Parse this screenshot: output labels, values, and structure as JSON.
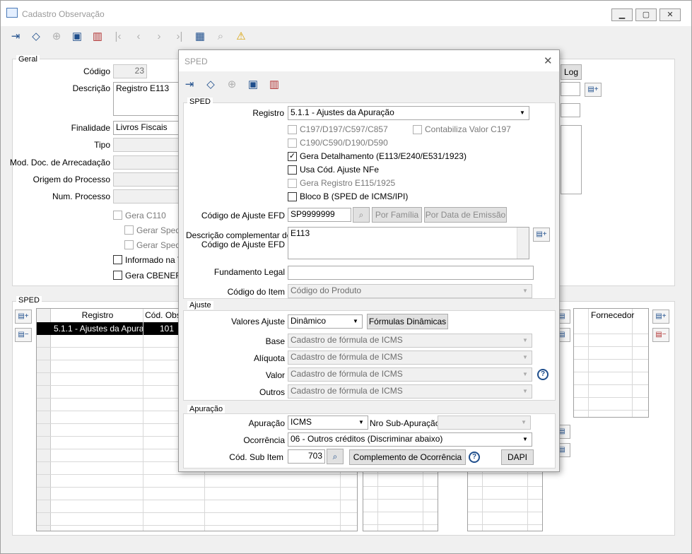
{
  "window": {
    "title": "Cadastro Observação",
    "min": "▁",
    "max": "▢",
    "close": "✕"
  },
  "main": {
    "geral_label": "Geral",
    "codigo_label": "Código",
    "codigo_value": "23",
    "descricao_label": "Descrição",
    "descricao_value": "Registro E113",
    "finalidade_label": "Finalidade",
    "finalidade_value": "Livros Fiscais",
    "tipo_label": "Tipo",
    "mod_doc_label": "Mod. Doc. de Arrecadação",
    "origem_label": "Origem do Processo",
    "num_proc_label": "Num. Processo",
    "gera_c110": "Gera C110",
    "gerar_sped_1": "Gerar Sped F",
    "gerar_sped_2": "Gerar Sped C",
    "informado": "Informado na Tri",
    "gera_cbenef": "Gera CBENEF F",
    "log_button": "Log",
    "sped_label": "SPED",
    "grid_headers": [
      "Registro",
      "Cód. Obs"
    ],
    "grid_row": [
      "5.1.1 - Ajustes da Apuraçã",
      "101"
    ],
    "fornecedor_header": "Fornecedor"
  },
  "dialog": {
    "title": "SPED",
    "close": "✕",
    "sped_group": "SPED",
    "registro_label": "Registro",
    "registro_value": "5.1.1 - Ajustes da Apuração",
    "cb_c197": "C197/D197/C597/C857",
    "cb_contabiliza": "Contabiliza Valor C197",
    "cb_c190": "C190/C590/D190/D590",
    "cb_gera_det": "Gera Detalhamento (E113/E240/E531/1923)",
    "cb_usa_cod": "Usa Cód. Ajuste NFe",
    "cb_gera_reg": "Gera Registro E115/1925",
    "cb_bloco_b": "Bloco B (SPED de ICMS/IPI)",
    "cod_ajuste_label": "Código de Ajuste EFD",
    "cod_ajuste_value": "SP9999999",
    "por_familia": "Por Família",
    "por_data": "Por Data de Emissão",
    "desc_comp_label_1": "Descrição complementar do",
    "desc_comp_label_2": "Código de Ajuste EFD",
    "desc_comp_value": "E113",
    "fundamento_label": "Fundamento Legal",
    "fundamento_value": "",
    "cod_item_label": "Código do Item",
    "cod_item_value": "Código do Produto",
    "ajuste_group": "Ajuste",
    "valores_label": "Valores Ajuste",
    "valores_value": "Dinâmico",
    "formulas_button": "Fórmulas Dinâmicas",
    "base_label": "Base",
    "base_value": "Cadastro de fórmula de ICMS",
    "aliquota_label": "Alíquota",
    "aliquota_value": "Cadastro de fórmula de ICMS",
    "valor_label": "Valor",
    "valor_value": "Cadastro de fórmula de ICMS",
    "outros_label": "Outros",
    "outros_value": "Cadastro de fórmula de ICMS",
    "apuracao_group": "Apuração",
    "apuracao_label": "Apuração",
    "apuracao_value": "ICMS",
    "nro_sub_label": "Nro Sub-Apuração",
    "nro_sub_value": "",
    "ocorrencia_label": "Ocorrência",
    "ocorrencia_value": "06 - Outros créditos (Discriminar abaixo)",
    "cod_sub_label": "Cód. Sub Item",
    "cod_sub_value": "703",
    "complemento_button": "Complemento de Ocorrência",
    "dapi_button": "DAPI"
  }
}
